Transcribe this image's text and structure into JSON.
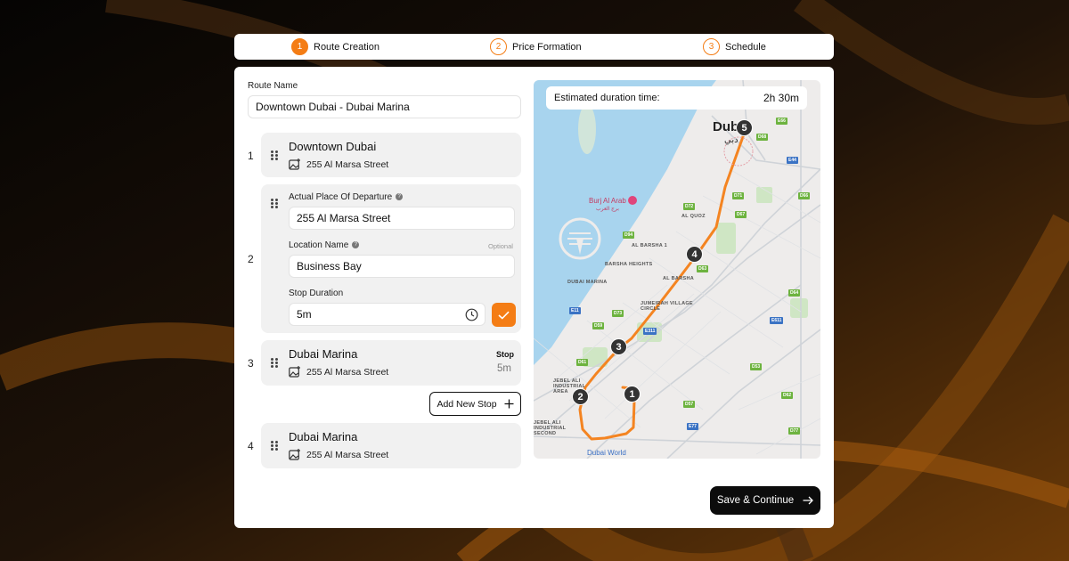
{
  "steps": [
    {
      "num": "1",
      "label": "Route Creation"
    },
    {
      "num": "2",
      "label": "Price Formation"
    },
    {
      "num": "3",
      "label": "Schedule"
    }
  ],
  "route_name": {
    "label": "Route Name",
    "value": "Downtown Dubai - Dubai Marina"
  },
  "stops": [
    {
      "num": "1",
      "title": "Downtown Dubai",
      "address": "255 Al Marsa Street"
    },
    {
      "num": "2",
      "departure_label": "Actual Place Of Departure",
      "departure_value": "255 Al Marsa Street",
      "location_label": "Location Name",
      "location_optional": "Optional",
      "location_value": "Business Bay",
      "duration_label": "Stop Duration",
      "duration_value": "5m"
    },
    {
      "num": "3",
      "title": "Dubai Marina",
      "address": "255 Al Marsa Street",
      "stop_label": "Stop",
      "stop_value": "5m"
    },
    {
      "num": "4",
      "title": "Dubai Marina",
      "address": "255 Al Marsa Street"
    }
  ],
  "add_stop_label": "Add New Stop",
  "save_label": "Save & Continue",
  "map": {
    "duration_label": "Estimated duration time:",
    "duration_value": "2h 30m",
    "city_label": "Dub",
    "city_arabic": "دبي",
    "poi_label": "Burj Al Arab",
    "poi_arabic": "برج العرب",
    "bottom_label": "Dubai World",
    "area_labels": [
      "AL QUOZ",
      "AL BARSHA 1",
      "BARSHA HEIGHTS",
      "DUBAI MARINA",
      "AL SUFOUH",
      "JUMEIRAH VILLAGE CIRCLE",
      "JEBEL ALI INDUSTRIAL AREA",
      "JEBEL ALI INDUSTRIAL SECOND",
      "AL BARSHA"
    ],
    "pins": [
      "1",
      "2",
      "3",
      "4",
      "5"
    ],
    "shields": [
      "E66",
      "D68",
      "E44",
      "D71",
      "D66",
      "D72",
      "E11",
      "D94",
      "D67",
      "D63",
      "D61",
      "D73",
      "D59",
      "E311",
      "D57",
      "D53",
      "D64",
      "D62",
      "E611",
      "D77",
      "E77"
    ]
  },
  "colors": {
    "accent": "#f47d15",
    "dark": "#0c0c0c",
    "route": "#f48421"
  }
}
